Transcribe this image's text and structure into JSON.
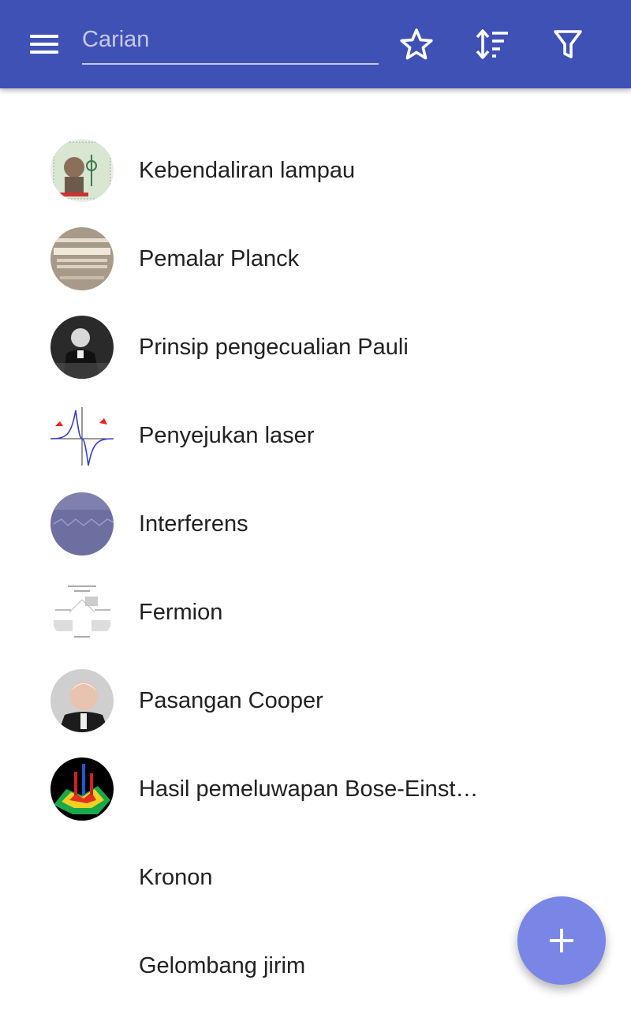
{
  "search": {
    "placeholder": "Carian",
    "value": ""
  },
  "colors": {
    "appbar": "#3f51b5",
    "fab": "#7986e6",
    "text": "#212121"
  },
  "toolbar": {
    "menu_icon": "menu-icon",
    "favorite_icon": "star-outline-icon",
    "sort_icon": "sort-icon",
    "filter_icon": "filter-outline-icon"
  },
  "articles": [
    {
      "title": "Kebendaliran lampau",
      "thumb": "stamp-portrait"
    },
    {
      "title": "Pemalar Planck",
      "thumb": "planck-medal"
    },
    {
      "title": "Prinsip pengecualian Pauli",
      "thumb": "bw-portrait"
    },
    {
      "title": "Penyejukan laser",
      "thumb": "graph-plot"
    },
    {
      "title": "Interferens",
      "thumb": "wave-surface"
    },
    {
      "title": "Fermion",
      "thumb": "text-diagram"
    },
    {
      "title": "Pasangan Cooper",
      "thumb": "elderly-portrait"
    },
    {
      "title": "Hasil pemeluwapan Bose-Einstein",
      "thumb": "colored-3d-plot"
    },
    {
      "title": "Kronon",
      "thumb": ""
    },
    {
      "title": "Gelombang jirim",
      "thumb": ""
    }
  ],
  "fab": {
    "icon": "plus-icon"
  }
}
